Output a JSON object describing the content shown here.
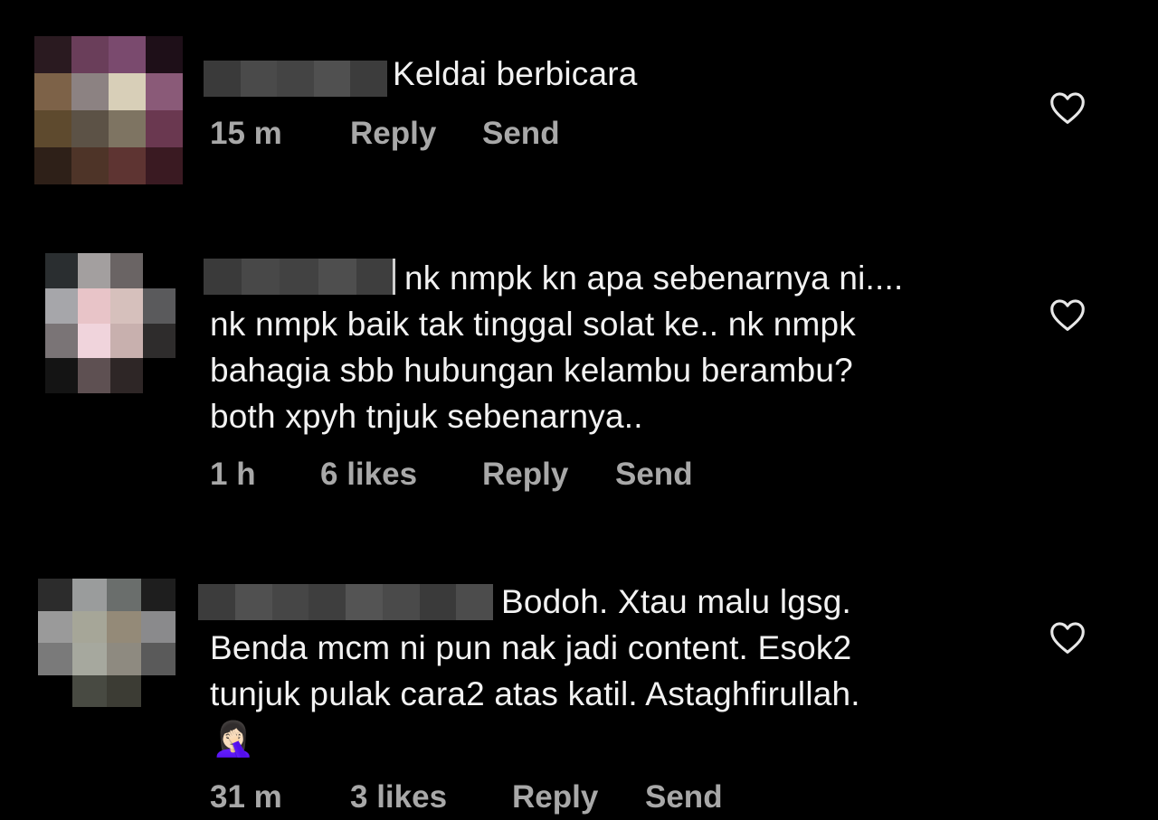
{
  "comments": [
    {
      "text_lines": [
        "Keldai berbicara"
      ],
      "time": "15 m",
      "likes": "",
      "reply": "Reply",
      "send": "Send"
    },
    {
      "text_lines": [
        "nk nmpk kn apa sebenarnya ni....",
        "nk nmpk baik tak tinggal solat ke.. nk nmpk",
        "bahagia sbb hubungan kelambu berambu?",
        "both xpyh tnjuk sebenarnya.."
      ],
      "time": "1 h",
      "likes": "6 likes",
      "reply": "Reply",
      "send": "Send"
    },
    {
      "text_lines": [
        "Bodoh. Xtau malu lgsg.",
        "Benda mcm ni pun nak jadi content. Esok2",
        "tunjuk pulak cara2 atas katil. Astaghfirullah.",
        "🤦🏻‍♀️"
      ],
      "time": "31 m",
      "likes": "3 likes",
      "reply": "Reply",
      "send": "Send"
    }
  ],
  "icons": {
    "like": "heart-outline-icon"
  },
  "colors": {
    "background": "#000000",
    "text": "#f2f2f2",
    "meta": "#a8a8a8"
  }
}
